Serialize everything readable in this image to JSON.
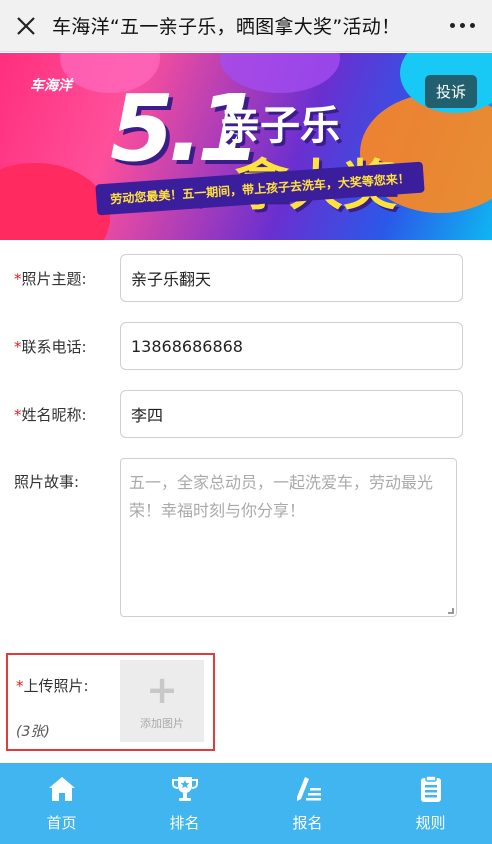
{
  "header": {
    "title": "车海洋“五一亲子乐，晒图拿大奖”活动！",
    "close_icon": "close-icon",
    "more_icon": "more-dots-icon"
  },
  "banner": {
    "logo_text": "车海洋",
    "big_number": "5.1",
    "headline_1": "亲子乐",
    "headline_2": "晒图",
    "headline_3": "拿大奖",
    "subtitle": "劳动您最美！五一期间，带上孩子去洗车，大奖等您来！",
    "complain_label": "投诉"
  },
  "form": {
    "required_mark": "*",
    "topic": {
      "label": "照片主题:",
      "value": "亲子乐翻天"
    },
    "phone": {
      "label": "联系电话:",
      "value": "13868686868"
    },
    "nickname": {
      "label": "姓名昵称:",
      "value": "李四"
    },
    "story": {
      "label": "照片故事:",
      "placeholder": "五一，全家总动员，一起洗爱车，劳动最光荣！幸福时刻与你分享！"
    },
    "upload": {
      "label": "上传照片:",
      "count": "(3张)",
      "add_label": "添加图片"
    }
  },
  "nav": {
    "items": [
      {
        "label": "首页",
        "icon": "home-icon"
      },
      {
        "label": "排名",
        "icon": "trophy-icon"
      },
      {
        "label": "报名",
        "icon": "edit-list-icon"
      },
      {
        "label": "规则",
        "icon": "clipboard-icon"
      }
    ]
  },
  "colors": {
    "accent": "#40b5f0",
    "required": "#e02020",
    "upload_border": "#e23b3b"
  }
}
